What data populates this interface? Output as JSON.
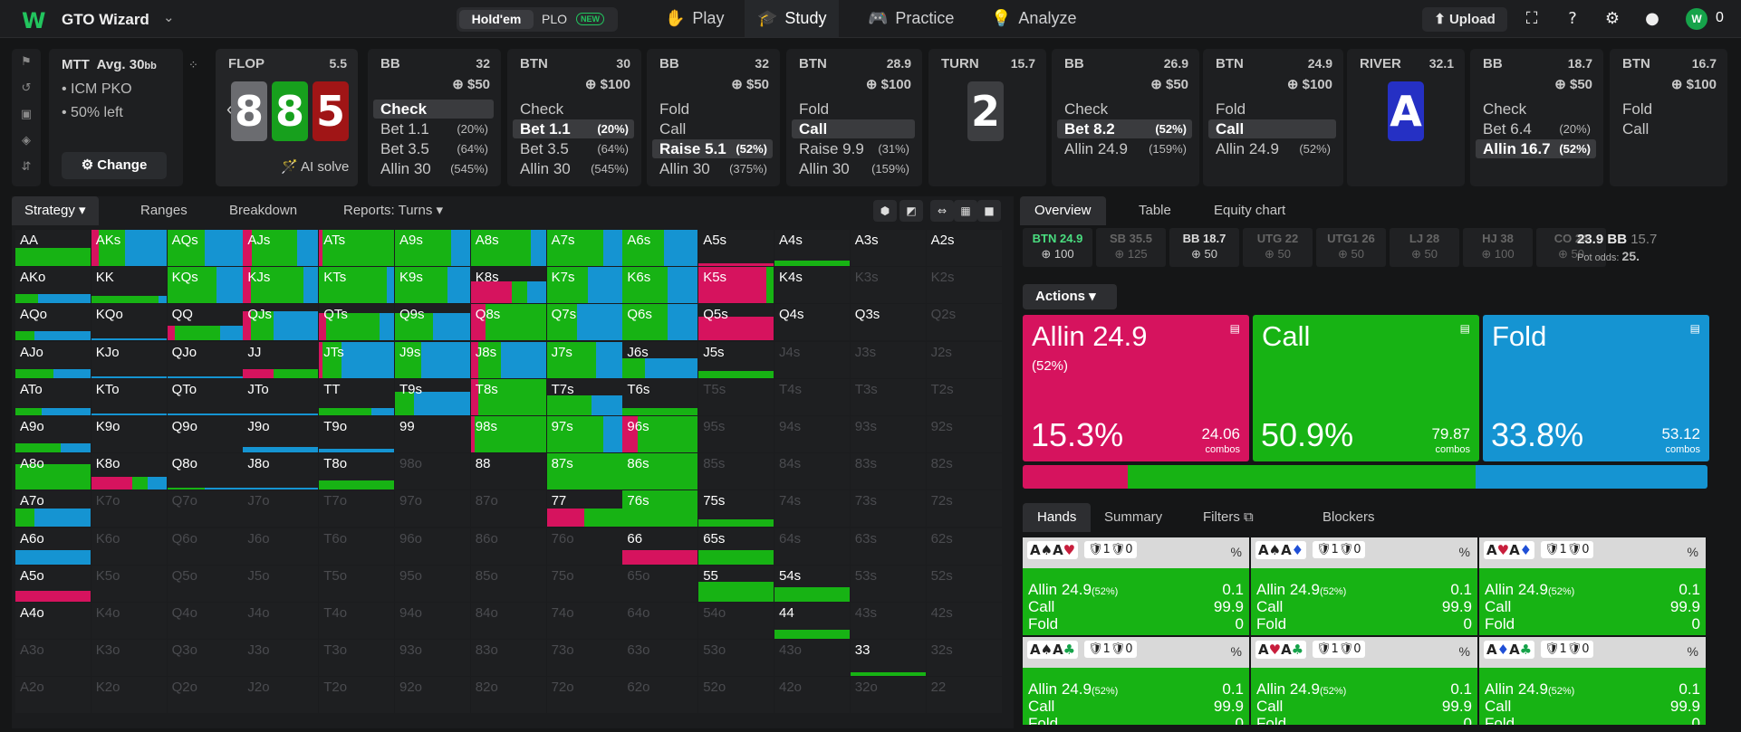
{
  "app": {
    "logo": "W",
    "name": "GTO Wizard",
    "chevron": "⌄",
    "toggle_a": "Hold'em",
    "toggle_b": "PLO",
    "toggle_new": "NEW",
    "nav": [
      {
        "label": "Play",
        "icon": "✋"
      },
      {
        "label": "Study",
        "icon": "🎓"
      },
      {
        "label": "Practice",
        "icon": "🎮"
      },
      {
        "label": "Analyze",
        "icon": "💡"
      }
    ],
    "upload": "⬆ Upload",
    "coin_value": "0"
  },
  "mtt": {
    "title": "MTT",
    "avg": "Avg. 30",
    "avg_unit": "bb",
    "line1": "• ICM PKO",
    "line2": "• 50% left",
    "change": "⚙ Change"
  },
  "flop": {
    "label": "FLOP",
    "pot": "5.5",
    "cards": [
      {
        "r": "8",
        "c": "#6b6c70"
      },
      {
        "r": "8",
        "c": "#17a01d"
      },
      {
        "r": "5",
        "c": "#a01516"
      }
    ],
    "ai": "🪄 AI solve"
  },
  "nodes": [
    {
      "pl": "BB",
      "pot": "32",
      "bet": "⊕ $50",
      "acts": [
        [
          "Check",
          ""
        ],
        [
          "Bet 1.1",
          "(20%)"
        ],
        [
          "Bet 3.5",
          "(64%)"
        ],
        [
          "Allin 30",
          "(545%)"
        ]
      ],
      "sel": 0
    },
    {
      "pl": "BTN",
      "pot": "30",
      "bet": "⊕ $100",
      "acts": [
        [
          "Check",
          ""
        ],
        [
          "Bet 1.1",
          "(20%)"
        ],
        [
          "Bet 3.5",
          "(64%)"
        ],
        [
          "Allin 30",
          "(545%)"
        ]
      ],
      "sel": 1
    },
    {
      "pl": "BB",
      "pot": "32",
      "bet": "⊕ $50",
      "acts": [
        [
          "Fold",
          ""
        ],
        [
          "Call",
          ""
        ],
        [
          "Raise 5.1",
          "(52%)"
        ],
        [
          "Allin 30",
          "(375%)"
        ]
      ],
      "sel": 2
    },
    {
      "pl": "BTN",
      "pot": "28.9",
      "bet": "⊕ $100",
      "acts": [
        [
          "Fold",
          ""
        ],
        [
          "Call",
          ""
        ],
        [
          "Raise 9.9",
          "(31%)"
        ],
        [
          "Allin 30",
          "(159%)"
        ]
      ],
      "sel": 1
    }
  ],
  "turn": {
    "label": "TURN",
    "pot": "15.7",
    "card": "2"
  },
  "nodes2": [
    {
      "pl": "BB",
      "pot": "26.9",
      "bet": "⊕ $50",
      "acts": [
        [
          "Check",
          ""
        ],
        [
          "Bet 8.2",
          "(52%)"
        ],
        [
          "Allin 24.9",
          "(159%)"
        ]
      ],
      "sel": 1
    },
    {
      "pl": "BTN",
      "pot": "24.9",
      "bet": "⊕ $100",
      "acts": [
        [
          "Fold",
          ""
        ],
        [
          "Call",
          ""
        ],
        [
          "Allin 24.9",
          "(52%)"
        ]
      ],
      "sel": 1
    }
  ],
  "river": {
    "label": "RIVER",
    "pot": "32.1",
    "card": "A"
  },
  "nodes3": [
    {
      "pl": "BB",
      "pot": "18.7",
      "bet": "⊕ $50",
      "acts": [
        [
          "Check",
          ""
        ],
        [
          "Bet 6.4",
          "(20%)"
        ],
        [
          "Allin 16.7",
          "(52%)"
        ]
      ],
      "sel": 2
    },
    {
      "pl": "BTN",
      "pot": "16.7",
      "bet": "⊕ $100",
      "acts": [
        [
          "Fold",
          ""
        ],
        [
          "Call",
          ""
        ]
      ],
      "sel": -1
    }
  ],
  "left_tabs": [
    "Strategy ▾",
    "Ranges",
    "Breakdown",
    "Reports: Turns ▾"
  ],
  "grid": [
    [
      "AA",
      "AKs",
      "AQs",
      "AJs",
      "ATs",
      "A9s",
      "A8s",
      "A7s",
      "A6s",
      "A5s",
      "A4s",
      "A3s",
      "A2s"
    ],
    [
      "AKo",
      "KK",
      "KQs",
      "KJs",
      "KTs",
      "K9s",
      "K8s",
      "K7s",
      "K6s",
      "K5s",
      "K4s",
      "K3s",
      "K2s"
    ],
    [
      "AQo",
      "KQo",
      "QQ",
      "QJs",
      "QTs",
      "Q9s",
      "Q8s",
      "Q7s",
      "Q6s",
      "Q5s",
      "Q4s",
      "Q3s",
      "Q2s"
    ],
    [
      "AJo",
      "KJo",
      "QJo",
      "JJ",
      "JTs",
      "J9s",
      "J8s",
      "J7s",
      "J6s",
      "J5s",
      "J4s",
      "J3s",
      "J2s"
    ],
    [
      "ATo",
      "KTo",
      "QTo",
      "JTo",
      "TT",
      "T9s",
      "T8s",
      "T7s",
      "T6s",
      "T5s",
      "T4s",
      "T3s",
      "T2s"
    ],
    [
      "A9o",
      "K9o",
      "Q9o",
      "J9o",
      "T9o",
      "99",
      "98s",
      "97s",
      "96s",
      "95s",
      "94s",
      "93s",
      "92s"
    ],
    [
      "A8o",
      "K8o",
      "Q8o",
      "J8o",
      "T8o",
      "98o",
      "88",
      "87s",
      "86s",
      "85s",
      "84s",
      "83s",
      "82s"
    ],
    [
      "A7o",
      "K7o",
      "Q7o",
      "J7o",
      "T7o",
      "97o",
      "87o",
      "77",
      "76s",
      "75s",
      "74s",
      "73s",
      "72s"
    ],
    [
      "A6o",
      "K6o",
      "Q6o",
      "J6o",
      "T6o",
      "96o",
      "86o",
      "76o",
      "66",
      "65s",
      "64s",
      "63s",
      "62s"
    ],
    [
      "A5o",
      "K5o",
      "Q5o",
      "J5o",
      "T5o",
      "95o",
      "85o",
      "75o",
      "65o",
      "55",
      "54s",
      "53s",
      "52s"
    ],
    [
      "A4o",
      "K4o",
      "Q4o",
      "J4o",
      "T4o",
      "94o",
      "84o",
      "74o",
      "64o",
      "54o",
      "44",
      "43s",
      "42s"
    ],
    [
      "A3o",
      "K3o",
      "Q3o",
      "J3o",
      "T3o",
      "93o",
      "83o",
      "73o",
      "63o",
      "53o",
      "43o",
      "33",
      "32s"
    ],
    [
      "A2o",
      "K2o",
      "Q2o",
      "J2o",
      "T2o",
      "92o",
      "82o",
      "72o",
      "62o",
      "52o",
      "42o",
      "32o",
      "22"
    ]
  ],
  "right_tabs": [
    "Overview",
    "Table",
    "Equity chart"
  ],
  "stacks": [
    [
      "BTN 24.9",
      "⊕ 100"
    ],
    [
      "SB 35.5",
      "⊕ 125"
    ],
    [
      "BB 18.7",
      "⊕ 50"
    ],
    [
      "UTG 22",
      "⊕ 50"
    ],
    [
      "UTG1 26",
      "⊕ 50"
    ],
    [
      "LJ 28",
      "⊕ 50"
    ],
    [
      "HJ 38",
      "⊕ 100"
    ],
    [
      "CO 24",
      "⊕ 50"
    ]
  ],
  "pot": {
    "value": "23.9 BB",
    "extra": "15.7",
    "odds_label": "Pot odds:",
    "odds": "25."
  },
  "actions_tab": "Actions ▾",
  "big": [
    {
      "t": "Allin 24.9",
      "sub": "(52%)",
      "pct": "15.3%",
      "cv": "24.06",
      "cl": "combos",
      "color": "#d6135e"
    },
    {
      "t": "Call",
      "sub": "",
      "pct": "50.9%",
      "cv": "79.87",
      "cl": "combos",
      "color": "#17b314"
    },
    {
      "t": "Fold",
      "sub": "",
      "pct": "33.8%",
      "cv": "53.12",
      "cl": "combos",
      "color": "#1594d2"
    }
  ],
  "freq": [
    0.153,
    0.509,
    0.338
  ],
  "hand_tabs": [
    "Hands",
    "Summary",
    "Filters ⧉",
    "Blockers"
  ],
  "hands": [
    {
      "cards": "A♠A♥",
      "blk": "🛡1🛡0"
    },
    {
      "cards": "A♠A♦",
      "blk": "🛡1🛡0"
    },
    {
      "cards": "A♥A♦",
      "blk": "🛡1🛡0"
    },
    {
      "cards": "A♠A♣",
      "blk": "🛡1🛡0"
    },
    {
      "cards": "A♥A♣",
      "blk": "🛡1🛡0"
    },
    {
      "cards": "A♦A♣",
      "blk": "🛡1🛡0"
    }
  ],
  "hand_rows": [
    [
      "Allin 24.9",
      "(52%)",
      "0.1"
    ],
    [
      "Call",
      "",
      "99.9"
    ],
    [
      "Fold",
      "",
      "0"
    ]
  ],
  "pct_sym": "%"
}
